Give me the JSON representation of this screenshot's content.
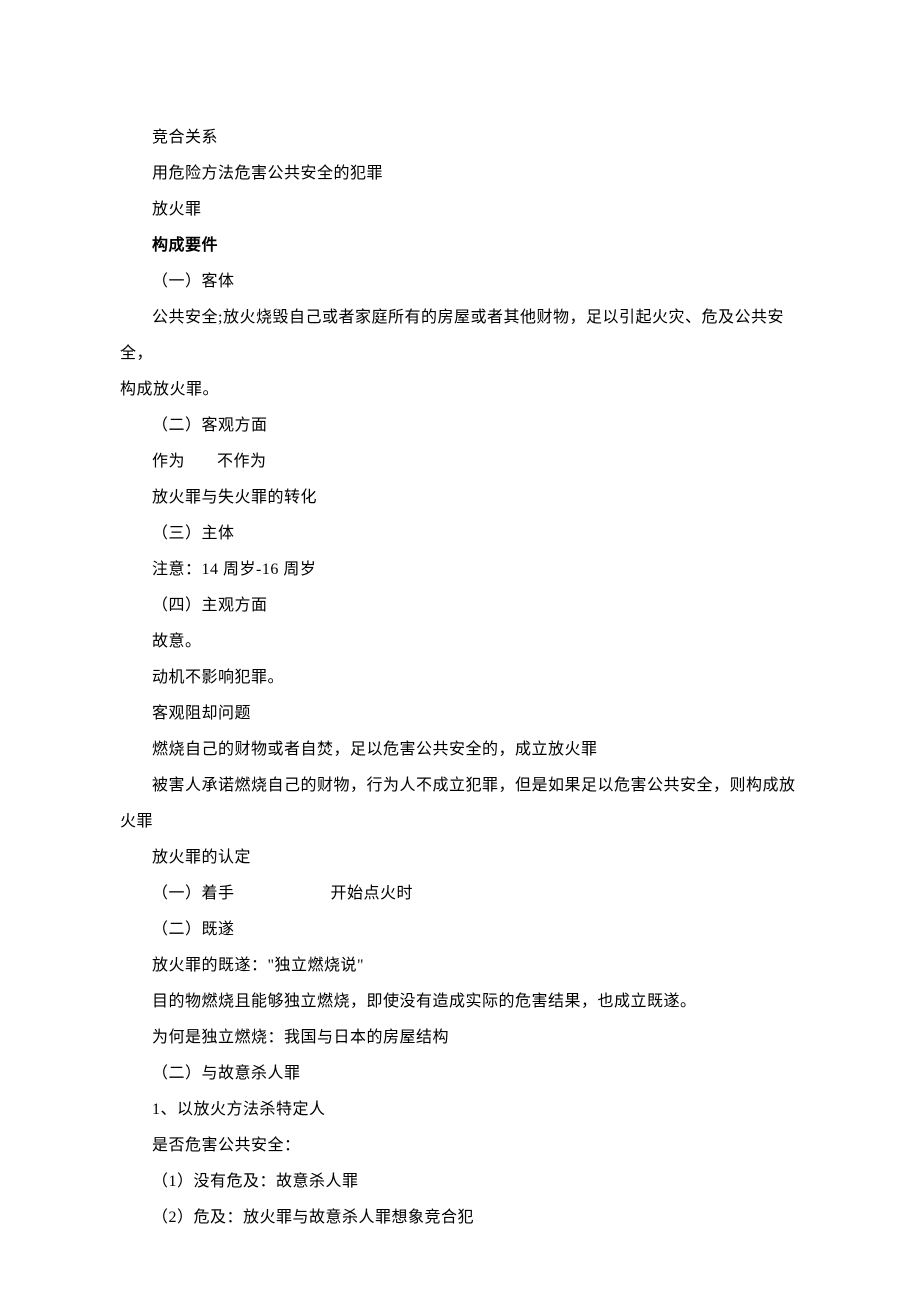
{
  "lines": [
    {
      "text": "竞合关系",
      "bold": false,
      "indent": true
    },
    {
      "text": "用危险方法危害公共安全的犯罪",
      "bold": false,
      "indent": true
    },
    {
      "text": "放火罪",
      "bold": false,
      "indent": true
    },
    {
      "text": "构成要件",
      "bold": true,
      "indent": true
    },
    {
      "text": "（一）客体",
      "bold": false,
      "indent": true
    },
    {
      "text": "公共安全;放火烧毁自己或者家庭所有的房屋或者其他财物，足以引起火灾、危及公共安全，",
      "bold": false,
      "indent": true
    },
    {
      "text": "构成放火罪。",
      "bold": false,
      "indent": false
    },
    {
      "text": "（二）客观方面",
      "bold": false,
      "indent": true
    },
    {
      "segments": [
        "作为",
        "不作为"
      ],
      "gap": "small",
      "bold": false,
      "indent": true
    },
    {
      "text": "放火罪与失火罪的转化",
      "bold": false,
      "indent": true
    },
    {
      "text": "（三）主体",
      "bold": false,
      "indent": true
    },
    {
      "text": "注意：14 周岁-16 周岁",
      "bold": false,
      "indent": true
    },
    {
      "text": "（四）主观方面",
      "bold": false,
      "indent": true
    },
    {
      "text": "故意。",
      "bold": false,
      "indent": true
    },
    {
      "text": "动机不影响犯罪。",
      "bold": false,
      "indent": true
    },
    {
      "text": "客观阻却问题",
      "bold": false,
      "indent": true
    },
    {
      "text": "燃烧自己的财物或者自焚，足以危害公共安全的，成立放火罪",
      "bold": false,
      "indent": true
    },
    {
      "text": "被害人承诺燃烧自己的财物，行为人不成立犯罪，但是如果足以危害公共安全，则构成放",
      "bold": false,
      "indent": true
    },
    {
      "text": "火罪",
      "bold": false,
      "indent": false
    },
    {
      "text": "放火罪的认定",
      "bold": false,
      "indent": true
    },
    {
      "segments": [
        "（一）着手",
        "开始点火时"
      ],
      "gap": "large",
      "bold": false,
      "indent": true
    },
    {
      "text": "（二）既遂",
      "bold": false,
      "indent": true
    },
    {
      "text": "放火罪的既遂：\"独立燃烧说\"",
      "bold": false,
      "indent": true
    },
    {
      "text": "目的物燃烧且能够独立燃烧，即使没有造成实际的危害结果，也成立既遂。",
      "bold": false,
      "indent": true
    },
    {
      "text": "为何是独立燃烧：我国与日本的房屋结构",
      "bold": false,
      "indent": true
    },
    {
      "text": "（二）与故意杀人罪",
      "bold": false,
      "indent": true
    },
    {
      "text": "1、以放火方法杀特定人",
      "bold": false,
      "indent": true
    },
    {
      "text": "是否危害公共安全：",
      "bold": false,
      "indent": true
    },
    {
      "text": "（1）没有危及：故意杀人罪",
      "bold": false,
      "indent": true
    },
    {
      "text": "（2）危及：放火罪与故意杀人罪想象竞合犯",
      "bold": false,
      "indent": true
    }
  ]
}
